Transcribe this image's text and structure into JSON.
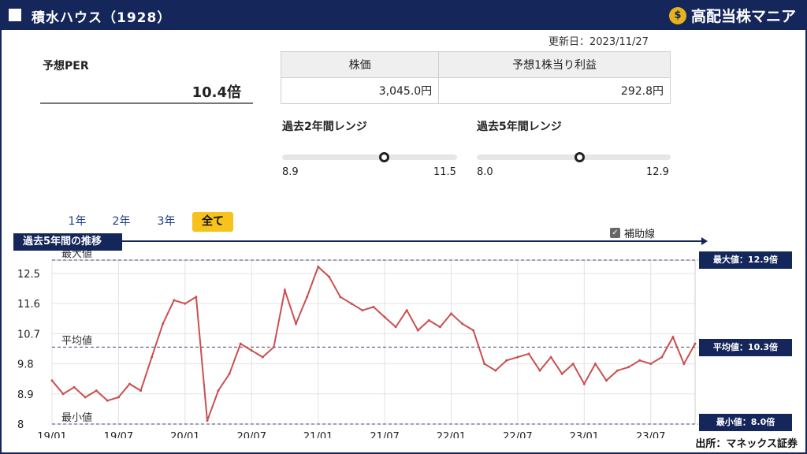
{
  "header": {
    "title": "積水ハウス（1928）",
    "brand": "高配当株マニア",
    "brand_icon": "money-bag-icon",
    "background_color": "#14265a"
  },
  "updated": "更新日：2023/11/27",
  "per": {
    "label": "予想PER",
    "value": "10.4倍"
  },
  "info_table": {
    "headers": [
      "株価",
      "予想1株当り利益"
    ],
    "values": [
      "3,045.0円",
      "292.8円"
    ]
  },
  "ranges": [
    {
      "label": "過去2年間レンジ",
      "min": "8.9",
      "max": "11.5",
      "position": 0.58
    },
    {
      "label": "過去5年間レンジ",
      "min": "8.0",
      "max": "12.9",
      "position": 0.53
    }
  ],
  "tabs": [
    {
      "label": "1年",
      "active": false
    },
    {
      "label": "2年",
      "active": false
    },
    {
      "label": "3年",
      "active": false
    },
    {
      "label": "全て",
      "active": true
    }
  ],
  "trend_label": "過去5年間の推移",
  "aux_lines": {
    "label": "補助線",
    "checked": true
  },
  "reference_lines": {
    "max_label": "最大値",
    "avg_label": "平均値",
    "min_label": "最小値",
    "max_badge": "最大値：12.9倍",
    "avg_badge": "平均値：10.3倍",
    "min_badge": "最小値：8.0倍"
  },
  "source": "出所：マネックス証券",
  "chart_data": {
    "type": "line",
    "title": "",
    "xlabel": "",
    "ylabel": "",
    "x_ticks": [
      "19/01",
      "19/07",
      "20/01",
      "20/07",
      "21/01",
      "21/07",
      "22/01",
      "22/07",
      "23/01",
      "23/07"
    ],
    "y_ticks": [
      "12.5",
      "11.6",
      "10.7",
      "9.8",
      "8.9",
      "8"
    ],
    "ylim": [
      8,
      12.9
    ],
    "line_color": "#c9504f",
    "series": [
      {
        "x": [
          "19/01",
          "19/02",
          "19/03",
          "19/04",
          "19/05",
          "19/06",
          "19/07",
          "19/08",
          "19/09",
          "19/10",
          "19/11",
          "19/12",
          "20/01",
          "20/02",
          "20/03",
          "20/04",
          "20/05",
          "20/06",
          "20/07",
          "20/08",
          "20/09",
          "20/10",
          "20/11",
          "20/12",
          "21/01",
          "21/02",
          "21/03",
          "21/04",
          "21/05",
          "21/06",
          "21/07",
          "21/08",
          "21/09",
          "21/10",
          "21/11",
          "21/12",
          "22/01",
          "22/02",
          "22/03",
          "22/04",
          "22/05",
          "22/06",
          "22/07",
          "22/08",
          "22/09",
          "22/10",
          "22/11",
          "22/12",
          "23/01",
          "23/02",
          "23/03",
          "23/04",
          "23/05",
          "23/06",
          "23/07",
          "23/08",
          "23/09",
          "23/10",
          "23/11"
        ],
        "values": [
          9.3,
          8.9,
          9.1,
          8.8,
          9.0,
          8.7,
          8.8,
          9.2,
          9.0,
          10.0,
          11.0,
          11.7,
          11.6,
          11.8,
          8.1,
          9.0,
          9.5,
          10.4,
          10.2,
          10.0,
          10.3,
          12.0,
          11.0,
          11.8,
          12.7,
          12.4,
          11.8,
          11.6,
          11.4,
          11.5,
          11.2,
          10.9,
          11.4,
          10.8,
          11.1,
          10.9,
          11.3,
          11.0,
          10.8,
          9.8,
          9.6,
          9.9,
          10.0,
          10.1,
          9.6,
          10.0,
          9.5,
          9.8,
          9.2,
          9.8,
          9.3,
          9.6,
          9.7,
          9.9,
          9.8,
          10.0,
          10.6,
          9.8,
          10.4
        ]
      }
    ],
    "reference_lines": {
      "max": 12.9,
      "avg": 10.3,
      "min": 8.0
    },
    "grid": true
  }
}
